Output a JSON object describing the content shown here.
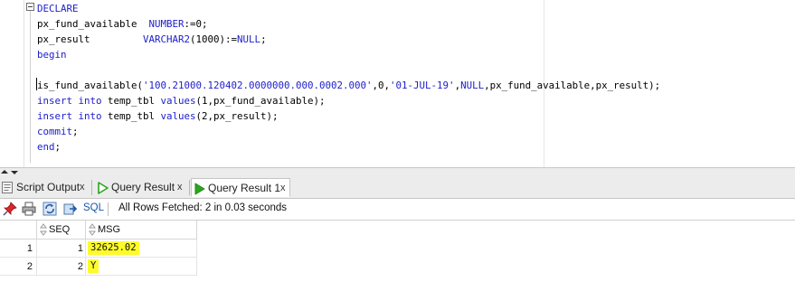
{
  "editor": {
    "lines": [
      [
        {
          "t": "DECLARE",
          "c": "kw"
        }
      ],
      [
        {
          "t": "px_fund_available  "
        },
        {
          "t": "NUMBER",
          "c": "kw"
        },
        {
          "t": ":=0;"
        }
      ],
      [
        {
          "t": "px_result         "
        },
        {
          "t": "VARCHAR2",
          "c": "kw"
        },
        {
          "t": "(1000):="
        },
        {
          "t": "NULL",
          "c": "kw"
        },
        {
          "t": ";"
        }
      ],
      [
        {
          "t": "begin",
          "c": "kw"
        }
      ],
      [
        {
          "t": ""
        }
      ],
      [
        {
          "t": "is_fund_available("
        },
        {
          "t": "'100.21000.120402.0000000.000.0002.000'",
          "c": "str"
        },
        {
          "t": ",0,"
        },
        {
          "t": "'01-JUL-19'",
          "c": "str"
        },
        {
          "t": ","
        },
        {
          "t": "NULL",
          "c": "kw"
        },
        {
          "t": ",px_fund_available,px_result);"
        }
      ],
      [
        {
          "t": "insert into",
          "c": "kw"
        },
        {
          "t": " temp_tbl "
        },
        {
          "t": "values",
          "c": "kw"
        },
        {
          "t": "(1,px_fund_available);"
        }
      ],
      [
        {
          "t": "insert into",
          "c": "kw"
        },
        {
          "t": " temp_tbl "
        },
        {
          "t": "values",
          "c": "kw"
        },
        {
          "t": "(2,px_result);"
        }
      ],
      [
        {
          "t": "commit",
          "c": "kw"
        },
        {
          "t": ";"
        }
      ],
      [
        {
          "t": "end",
          "c": "kw"
        },
        {
          "t": ";"
        }
      ]
    ]
  },
  "tabs": [
    {
      "label": "Script Output",
      "icon": "script-output-icon",
      "close": "x",
      "active": false
    },
    {
      "label": "Query Result",
      "icon": "run-icon",
      "close": "x",
      "active": false
    },
    {
      "label": "Query Result 1",
      "icon": "run-icon",
      "close": "x",
      "active": true
    }
  ],
  "toolbar": {
    "sql_label": "SQL",
    "status": "All Rows Fetched: 2 in 0.03 seconds",
    "icons": [
      "pin-icon",
      "print-icon",
      "refresh-icon",
      "export-icon"
    ]
  },
  "grid": {
    "columns": [
      "SEQ",
      "MSG"
    ],
    "rows": [
      {
        "rownum": "1",
        "seq": "1",
        "msg": "32625.02"
      },
      {
        "rownum": "2",
        "seq": "2",
        "msg": "Y"
      }
    ]
  },
  "colors": {
    "keyword": "#1c1ccc",
    "highlight": "#fdfb2a",
    "run_icon": "#2aa51c"
  }
}
